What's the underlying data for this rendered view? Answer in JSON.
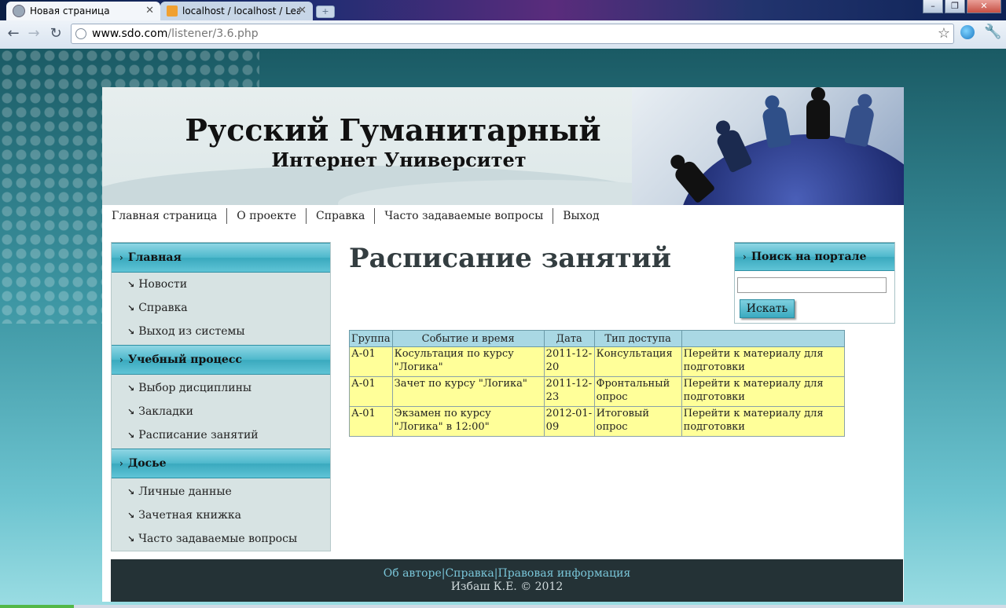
{
  "browser": {
    "tabs": [
      {
        "title": "Новая страница",
        "active": true
      },
      {
        "title": "localhost / localhost / LearnSy",
        "active": false
      }
    ],
    "window_controls": [
      "minimize-icon",
      "restore-icon",
      "close-icon"
    ],
    "url_host": "www.sdo.com",
    "url_path": "/listener/3.6.php"
  },
  "site": {
    "title": "Русский Гуманитарный",
    "subtitle": "Интернет Университет",
    "topnav": [
      "Главная страница",
      "О проекте",
      "Справка",
      "Часто задаваемые вопросы",
      "Выход"
    ]
  },
  "sidebar": {
    "sections": [
      {
        "title": "Главная",
        "items": [
          "Новости",
          "Справка",
          "Выход из системы"
        ]
      },
      {
        "title": "Учебный процесс",
        "items": [
          "Выбор дисциплины",
          "Закладки",
          "Расписание занятий"
        ]
      },
      {
        "title": "Досье",
        "items": [
          "Личные данные",
          "Зачетная книжка",
          "Часто задаваемые вопросы"
        ]
      }
    ]
  },
  "main": {
    "title": "Расписание занятий",
    "table": {
      "headers": [
        "Группа",
        "Событие и время",
        "Дата",
        "Тип доступа",
        ""
      ],
      "rows": [
        [
          "А-01",
          "Косультация по курсу \"Логика\"",
          "2011-12-20",
          "Консультация",
          "Перейти к материалу для подготовки"
        ],
        [
          "А-01",
          "Зачет по курсу \"Логика\"",
          "2011-12-23",
          "Фронтальный опрос",
          "Перейти к материалу для подготовки"
        ],
        [
          "А-01",
          "Экзамен по курсу \"Логика\" в 12:00\"",
          "2012-01-09",
          "Итоговый опрос",
          "Перейти к материалу для подготовки"
        ]
      ]
    }
  },
  "search": {
    "title": "Поиск на портале",
    "value": "",
    "button": "Искать"
  },
  "footer": {
    "links": [
      "Об авторе",
      "Справка",
      "Правовая информация"
    ],
    "separator": "|",
    "copyright": "Избаш К.Е. © 2012"
  },
  "colors": {
    "accent": "#4db8cc",
    "table_header": "#a9d8e4",
    "table_cell": "#ffff99",
    "footer_bg": "#243236"
  }
}
